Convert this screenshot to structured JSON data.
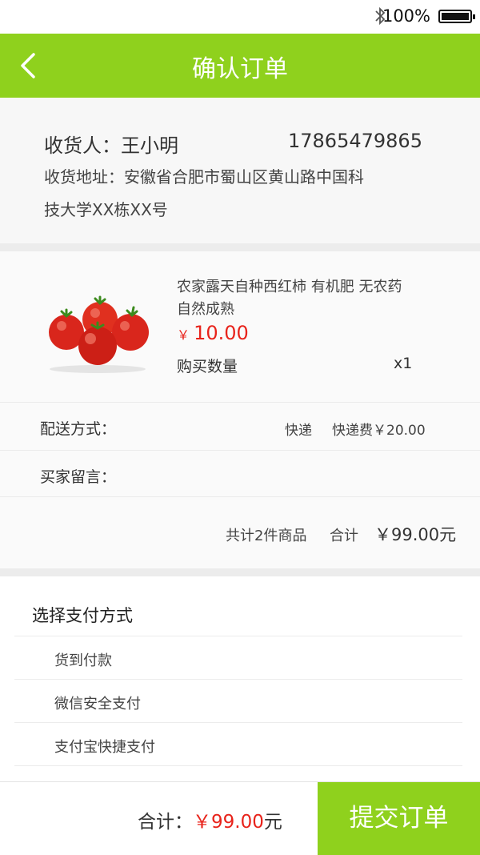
{
  "status_bar": {
    "battery": "100%"
  },
  "header": {
    "title": "确认订单"
  },
  "address": {
    "receiver": "收货人：王小明",
    "phone": "17865479865",
    "line1": "收货地址：安徽省合肥市蜀山区黄山路中国科",
    "line2": "技大学XX栋XX号"
  },
  "product": {
    "name_line1": "农家露天自种西红柿  有机肥  无农药",
    "name_line2": "自然成熟",
    "price_symbol": "￥",
    "price": "10.00",
    "qty_label": "购买数量",
    "qty": "x1"
  },
  "shipping": {
    "label": "配送方式：",
    "method": "快递",
    "fee": "快递费￥20.00"
  },
  "message": {
    "label": "买家留言："
  },
  "summary": {
    "count": "共计2件商品",
    "total_label": "合计",
    "total": "￥99.00元"
  },
  "payment": {
    "heading": "选择支付方式",
    "options": [
      "货到付款",
      "微信安全支付",
      "支付宝快捷支付"
    ]
  },
  "footer": {
    "total_label": "合计：",
    "total_amount": "￥99.00",
    "total_unit": "元",
    "submit": "提交订单"
  },
  "colors": {
    "accent": "#8fd11d",
    "price": "#e8231b"
  }
}
